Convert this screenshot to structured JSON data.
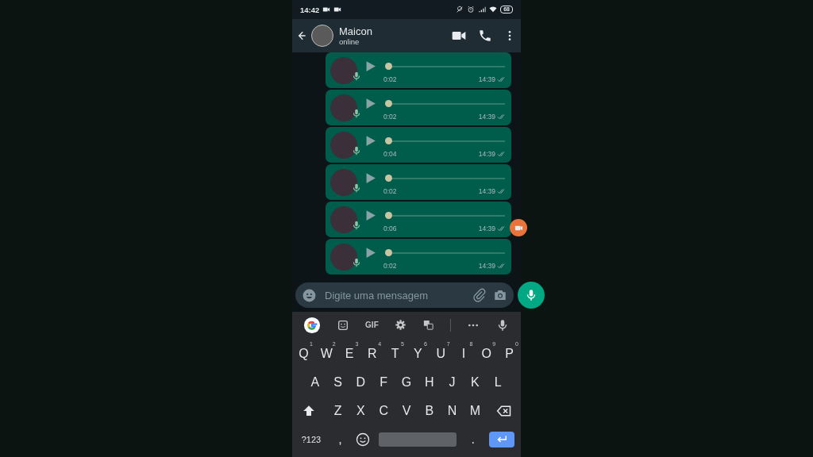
{
  "status_bar": {
    "time": "14:42",
    "battery": "68"
  },
  "header": {
    "name": "Maicon",
    "status": "online"
  },
  "messages": [
    {
      "duration": "0:02",
      "time": "14:39",
      "level": 0
    },
    {
      "duration": "0:02",
      "time": "14:39",
      "level": 0
    },
    {
      "duration": "0:04",
      "time": "14:39",
      "level": 0
    },
    {
      "duration": "0:02",
      "time": "14:39",
      "level": 0
    },
    {
      "duration": "0:06",
      "time": "14:39",
      "level": 0
    },
    {
      "duration": "0:02",
      "time": "14:39",
      "level": 0
    }
  ],
  "composer": {
    "placeholder": "Digite uma mensagem"
  },
  "keyboard_toolbar": {
    "gif": "GIF"
  },
  "keyboard": {
    "rows": [
      {
        "keys": [
          {
            "kind": "letter",
            "label": "Q",
            "hint": "1"
          },
          {
            "kind": "letter",
            "label": "W",
            "hint": "2"
          },
          {
            "kind": "letter",
            "label": "E",
            "hint": "3"
          },
          {
            "kind": "letter",
            "label": "R",
            "hint": "4"
          },
          {
            "kind": "letter",
            "label": "T",
            "hint": "5"
          },
          {
            "kind": "letter",
            "label": "Y",
            "hint": "6"
          },
          {
            "kind": "letter",
            "label": "U",
            "hint": "7"
          },
          {
            "kind": "letter",
            "label": "I",
            "hint": "8"
          },
          {
            "kind": "letter",
            "label": "O",
            "hint": "9"
          },
          {
            "kind": "letter",
            "label": "P",
            "hint": "0"
          }
        ]
      },
      {
        "keys": [
          {
            "kind": "letter",
            "label": "A"
          },
          {
            "kind": "letter",
            "label": "S"
          },
          {
            "kind": "letter",
            "label": "D"
          },
          {
            "kind": "letter",
            "label": "F"
          },
          {
            "kind": "letter",
            "label": "G"
          },
          {
            "kind": "letter",
            "label": "H"
          },
          {
            "kind": "letter",
            "label": "J"
          },
          {
            "kind": "letter",
            "label": "K"
          },
          {
            "kind": "letter",
            "label": "L"
          }
        ]
      },
      {
        "keys": [
          {
            "kind": "shift"
          },
          {
            "kind": "letter",
            "label": "Z"
          },
          {
            "kind": "letter",
            "label": "X"
          },
          {
            "kind": "letter",
            "label": "C"
          },
          {
            "kind": "letter",
            "label": "V"
          },
          {
            "kind": "letter",
            "label": "B"
          },
          {
            "kind": "letter",
            "label": "N"
          },
          {
            "kind": "letter",
            "label": "M"
          },
          {
            "kind": "backspace"
          }
        ]
      },
      {
        "keys": [
          {
            "kind": "symbols",
            "label": "?123"
          },
          {
            "kind": "letter",
            "label": ","
          },
          {
            "kind": "emoji"
          },
          {
            "kind": "space"
          },
          {
            "kind": "letter",
            "label": "."
          },
          {
            "kind": "enter"
          }
        ]
      }
    ]
  }
}
